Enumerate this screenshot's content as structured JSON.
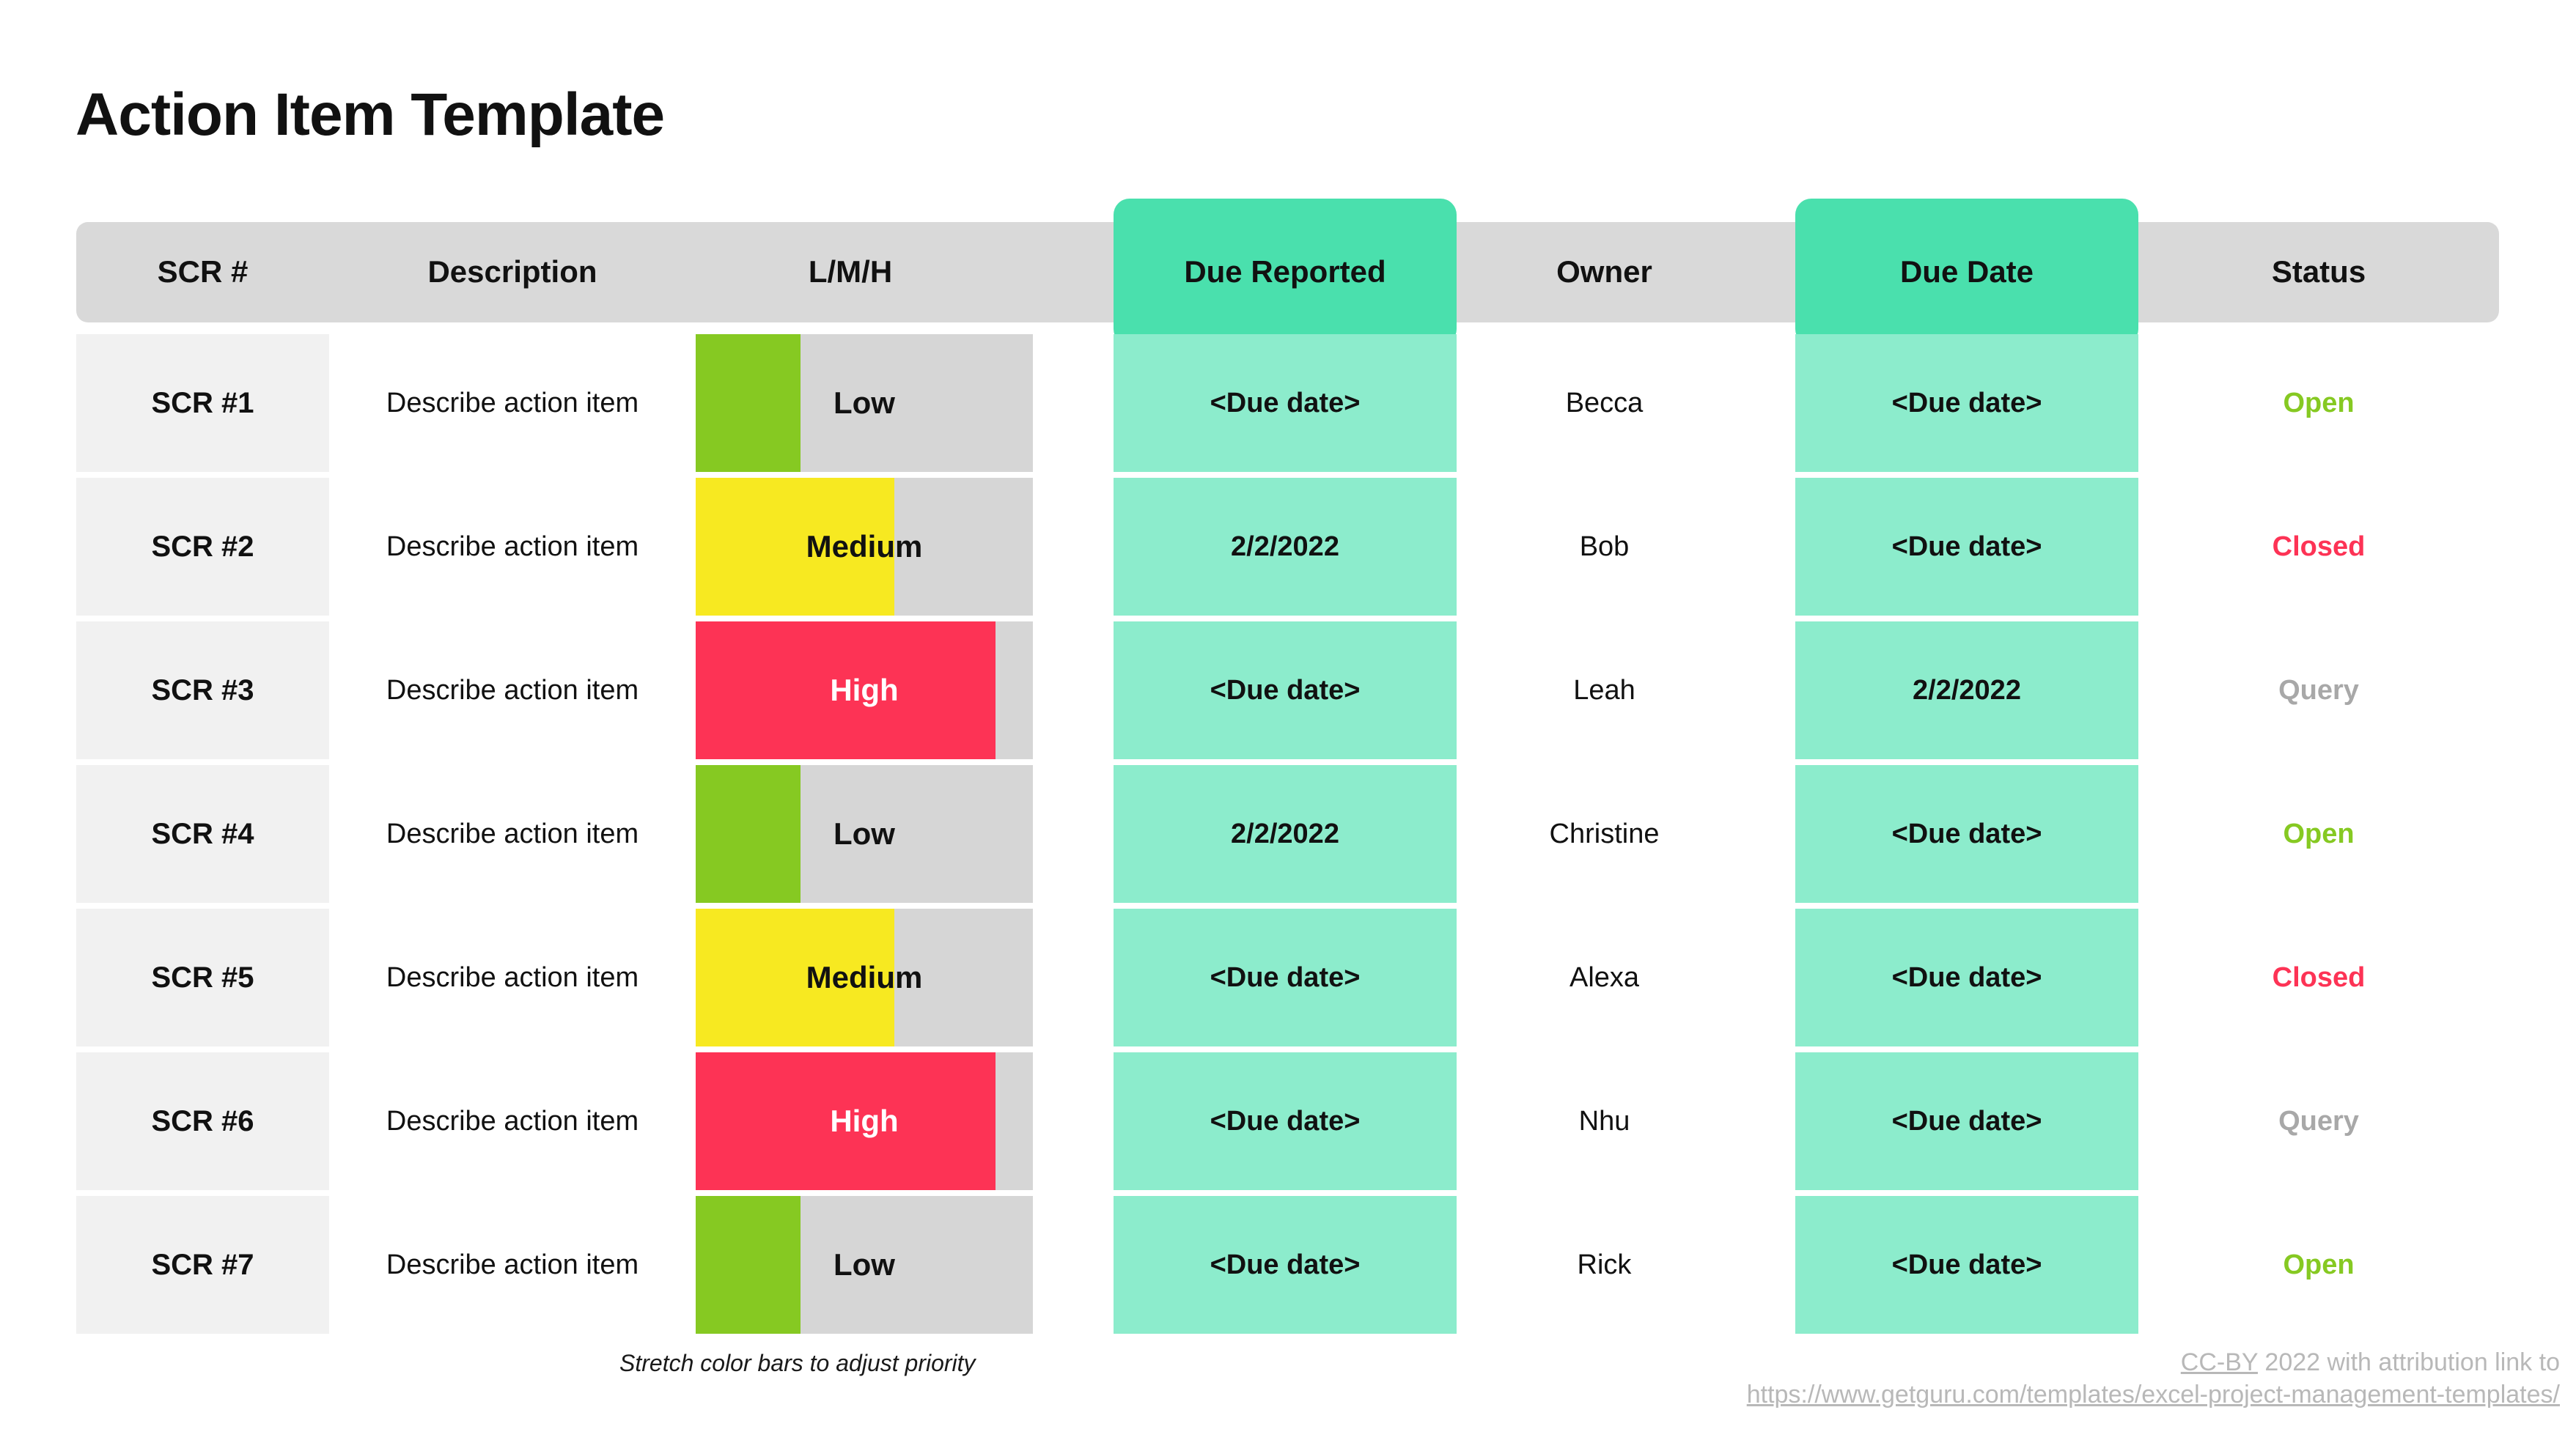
{
  "page": {
    "title": "Action Item Template",
    "background": "#ffffff"
  },
  "colors": {
    "header_gray": "#d9d9d9",
    "header_teal": "#4ae0ad",
    "cell_teal": "#8ceccc",
    "cell_gray": "#f1f1f1",
    "bar_track": "#d6d6d6",
    "priority_low": "#86c922",
    "priority_medium": "#f7e921",
    "priority_high": "#fd3355",
    "status_open": "#86c922",
    "status_closed": "#fd3355",
    "status_query": "#a8a8a8"
  },
  "table": {
    "columns": [
      {
        "key": "scr",
        "label": "SCR #",
        "style": "gray"
      },
      {
        "key": "description",
        "label": "Description",
        "style": "gray"
      },
      {
        "key": "lmh",
        "label": "L/M/H",
        "style": "gray"
      },
      {
        "key": "due_reported",
        "label": "Due Reported",
        "style": "teal"
      },
      {
        "key": "owner",
        "label": "Owner",
        "style": "gray"
      },
      {
        "key": "due_date",
        "label": "Due Date",
        "style": "teal"
      },
      {
        "key": "status",
        "label": "Status",
        "style": "gray"
      }
    ],
    "rows": [
      {
        "scr": "SCR #1",
        "description": "Describe action item",
        "priority": "Low",
        "priority_pct": 31,
        "priority_color": "#86c922",
        "priority_text_color": "#111111",
        "due_reported": "<Due date>",
        "owner": "Becca",
        "due_date": "<Due date>",
        "status": "Open",
        "status_color": "#86c922"
      },
      {
        "scr": "SCR #2",
        "description": "Describe action item",
        "priority": "Medium",
        "priority_pct": 59,
        "priority_color": "#f7e921",
        "priority_text_color": "#111111",
        "due_reported": "2/2/2022",
        "owner": "Bob",
        "due_date": "<Due date>",
        "status": "Closed",
        "status_color": "#fd3355"
      },
      {
        "scr": "SCR #3",
        "description": "Describe action item",
        "priority": "High",
        "priority_pct": 89,
        "priority_color": "#fd3355",
        "priority_text_color": "#ffffff",
        "due_reported": "<Due date>",
        "owner": "Leah",
        "due_date": "2/2/2022",
        "status": "Query",
        "status_color": "#a8a8a8"
      },
      {
        "scr": "SCR #4",
        "description": "Describe action item",
        "priority": "Low",
        "priority_pct": 31,
        "priority_color": "#86c922",
        "priority_text_color": "#111111",
        "due_reported": "2/2/2022",
        "owner": "Christine",
        "due_date": "<Due date>",
        "status": "Open",
        "status_color": "#86c922"
      },
      {
        "scr": "SCR #5",
        "description": "Describe action item",
        "priority": "Medium",
        "priority_pct": 59,
        "priority_color": "#f7e921",
        "priority_text_color": "#111111",
        "due_reported": "<Due date>",
        "owner": "Alexa",
        "due_date": "<Due date>",
        "status": "Closed",
        "status_color": "#fd3355"
      },
      {
        "scr": "SCR #6",
        "description": "Describe action item",
        "priority": "High",
        "priority_pct": 89,
        "priority_color": "#fd3355",
        "priority_text_color": "#ffffff",
        "due_reported": "<Due date>",
        "owner": "Nhu",
        "due_date": "<Due date>",
        "status": "Query",
        "status_color": "#a8a8a8"
      },
      {
        "scr": "SCR #7",
        "description": "Describe action item",
        "priority": "Low",
        "priority_pct": 31,
        "priority_color": "#86c922",
        "priority_text_color": "#111111",
        "due_reported": "<Due date>",
        "owner": "Rick",
        "due_date": "<Due date>",
        "status": "Open",
        "status_color": "#86c922"
      }
    ]
  },
  "footer": {
    "note": "Stretch color bars to adjust priority",
    "attribution_link_label": "CC-BY",
    "attribution_text": " 2022 with attribution link to",
    "attribution_url": "https://www.getguru.com/templates/excel-project-management-templates/"
  }
}
